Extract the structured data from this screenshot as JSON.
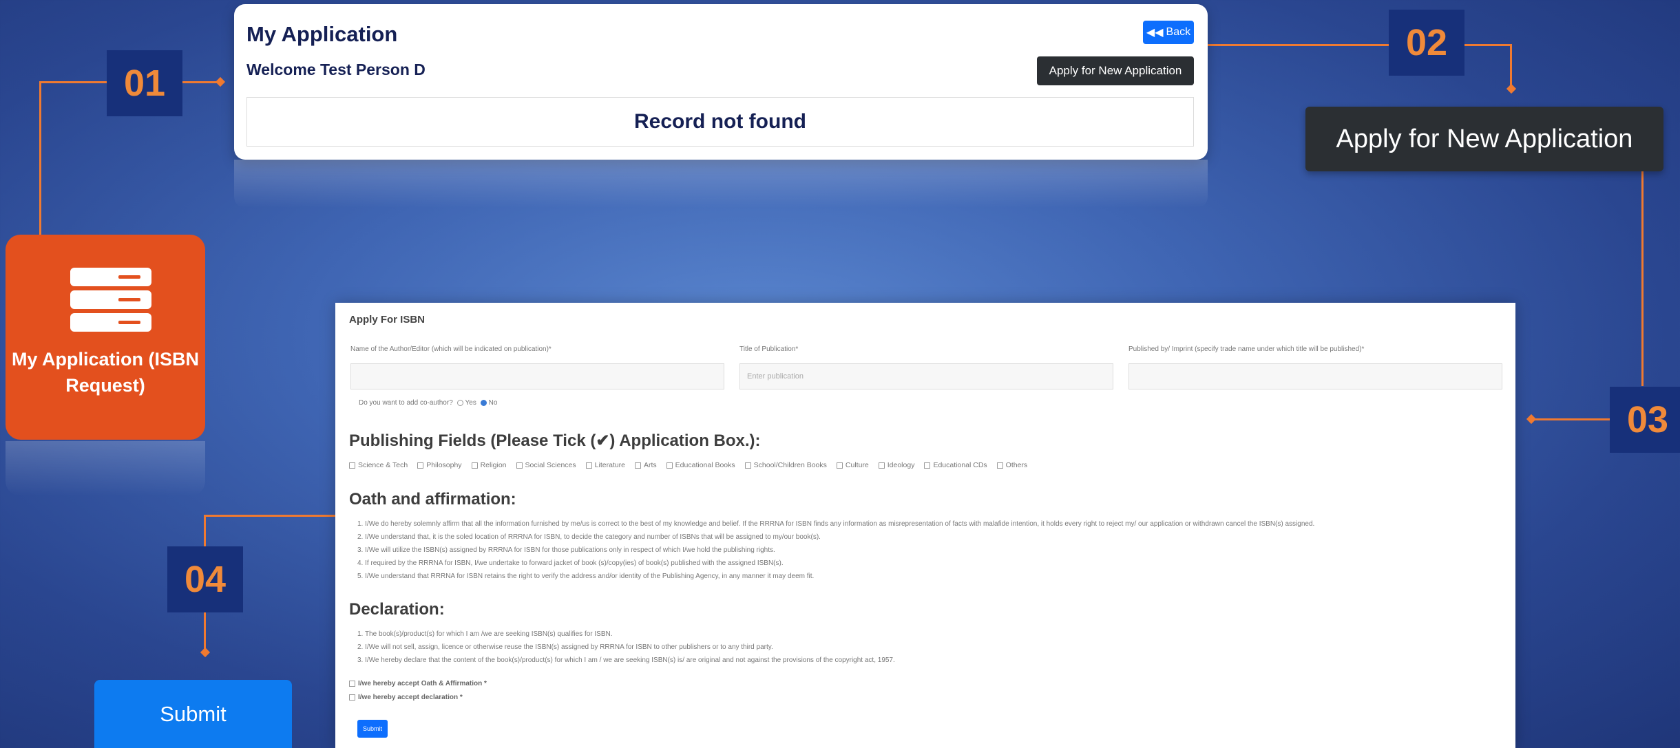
{
  "card": {
    "title": "My Application",
    "welcome": "Welcome Test Person D",
    "back_label": "Back",
    "apply_label": "Apply for New Application",
    "record_text": "Record not found"
  },
  "steps": [
    "01",
    "02",
    "03",
    "04"
  ],
  "callouts": {
    "apply_big_label": "Apply for New Application",
    "my_application_label": "My Application (ISBN Request)",
    "submit_label": "Submit"
  },
  "form": {
    "title": "Apply For ISBN",
    "author_label": "Name of the Author/Editor (which will be indicated on publication)*",
    "title_label": "Title of Publication*",
    "title_placeholder": "Enter publication",
    "publisher_label": "Published by/ Imprint (specify trade name under which title will be published)*",
    "coauthor_question": "Do you want to add co-author?",
    "yes_label": "Yes",
    "no_label": "No",
    "publishing_heading": "Publishing Fields (Please Tick (✔) Application Box.):",
    "fields": [
      "Science & Tech",
      "Philosophy",
      "Religion",
      "Social Sciences",
      "Literature",
      "Arts",
      "Educational Books",
      "School/Children Books",
      "Culture",
      "Ideology",
      "Educational CDs",
      "Others"
    ],
    "oath_heading": "Oath and affirmation:",
    "oath_items": [
      "1. I/We do hereby solemnly affirm that all the information furnished by me/us is correct to the best of my knowledge and belief. If the RRRNA for ISBN finds any information as misrepresentation of facts with malafide intention, it holds every right to reject my/ our application or withdrawn cancel the ISBN(s) assigned.",
      "2. I/We understand that, it is the soled location of RRRNA for ISBN, to decide the category and number of ISBNs that will be assigned to my/our book(s).",
      "3. I/We will utilize the ISBN(s) assigned by RRRNA for ISBN for those publications only in respect of which I/we hold the publishing rights.",
      "4. If required by the RRRNA for ISBN, I/we undertake to forward jacket of book (s)/copy(ies) of book(s) published with the assigned ISBN(s).",
      "5. I/We understand that RRRNA for ISBN retains the right to verify the address and/or identity of the Publishing Agency, in any manner it may deem fit."
    ],
    "declaration_heading": "Declaration:",
    "declaration_items": [
      "1. The book(s)/product(s) for which I am /we are seeking ISBN(s) qualifies for ISBN.",
      "2. I/We will not sell, assign, licence or otherwise reuse the ISBN(s) assigned by RRRNA for ISBN to other publishers or to any third party.",
      "3. I/We hereby declare that the content of the book(s)/product(s) for which I am / we are seeking ISBN(s) is/ are original and not against the provisions of the copyright act, 1957."
    ],
    "accept_oath": "I/we hereby accept Oath & Affirmation *",
    "accept_declaration": "I/we hereby accept declaration *",
    "submit_label": "Submit"
  },
  "colors": {
    "accent_orange": "#f07a30",
    "step_box": "#17307a",
    "callout_orange": "#e3501e",
    "primary_blue": "#0d6efd",
    "dark_button": "#2b2f33"
  }
}
